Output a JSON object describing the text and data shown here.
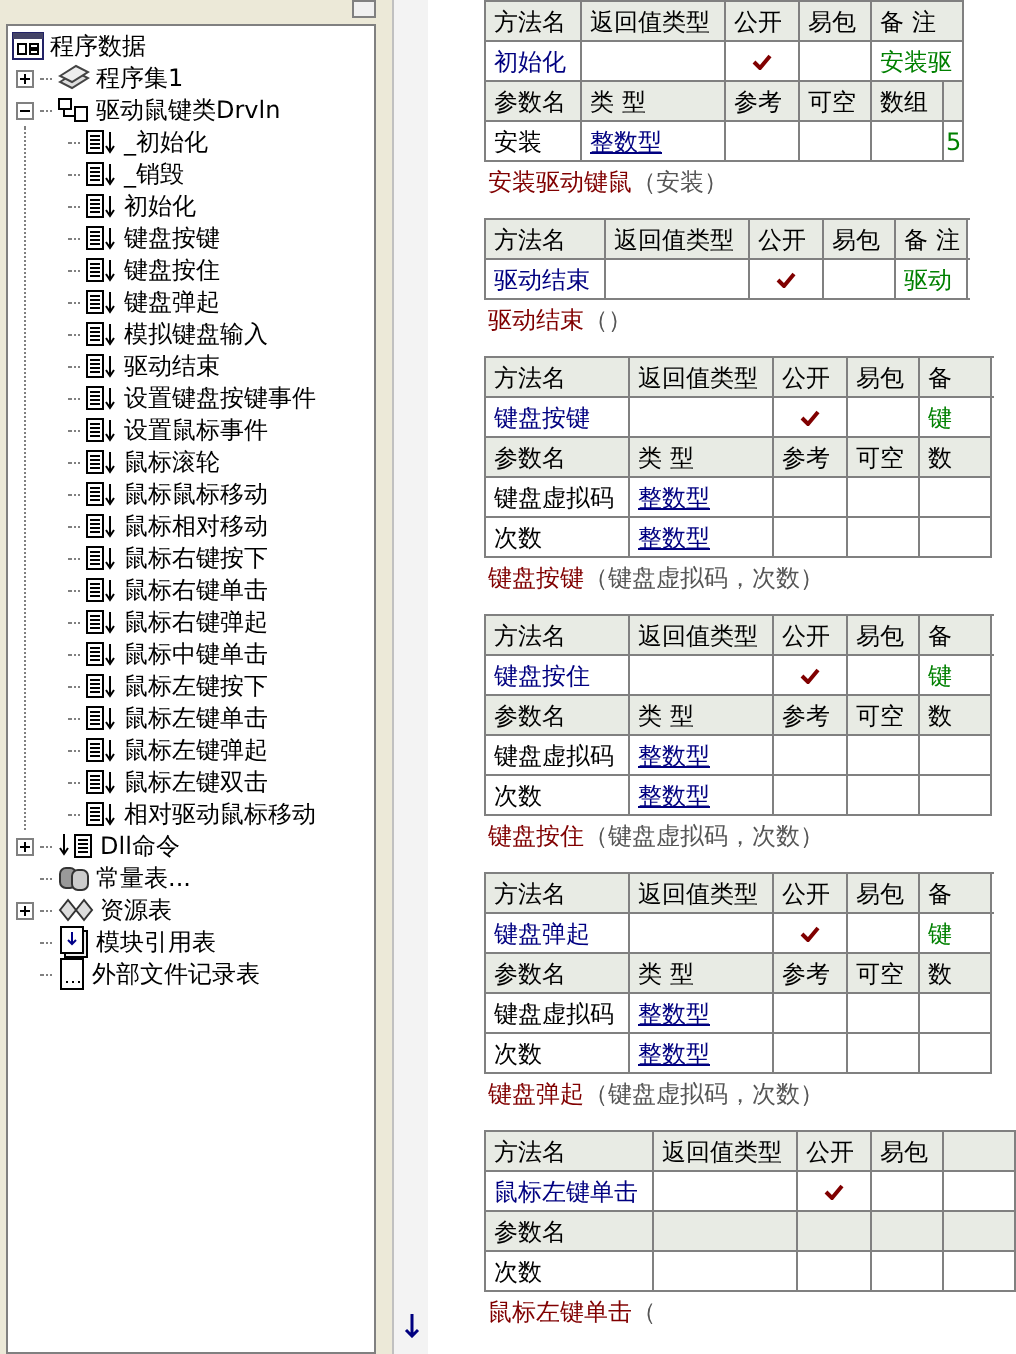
{
  "tree": {
    "root": "程序数据",
    "items": [
      {
        "kind": "assembly",
        "label": "程序集1",
        "expanded": false
      },
      {
        "kind": "class",
        "label": "驱动鼠键类Drvln",
        "expanded": true,
        "children": [
          {
            "kind": "method",
            "label": "_初始化"
          },
          {
            "kind": "method",
            "label": "_销毁"
          },
          {
            "kind": "method",
            "label": "初始化"
          },
          {
            "kind": "method",
            "label": "键盘按键"
          },
          {
            "kind": "method",
            "label": "键盘按住"
          },
          {
            "kind": "method",
            "label": "键盘弹起"
          },
          {
            "kind": "method",
            "label": "模拟键盘输入"
          },
          {
            "kind": "method",
            "label": "驱动结束"
          },
          {
            "kind": "method",
            "label": "设置键盘按键事件"
          },
          {
            "kind": "method",
            "label": "设置鼠标事件"
          },
          {
            "kind": "method",
            "label": "鼠标滚轮"
          },
          {
            "kind": "method",
            "label": "鼠标鼠标移动"
          },
          {
            "kind": "method",
            "label": "鼠标相对移动"
          },
          {
            "kind": "method",
            "label": "鼠标右键按下"
          },
          {
            "kind": "method",
            "label": "鼠标右键单击"
          },
          {
            "kind": "method",
            "label": "鼠标右键弹起"
          },
          {
            "kind": "method",
            "label": "鼠标中键单击"
          },
          {
            "kind": "method",
            "label": "鼠标左键按下"
          },
          {
            "kind": "method",
            "label": "鼠标左键单击"
          },
          {
            "kind": "method",
            "label": "鼠标左键弹起"
          },
          {
            "kind": "method",
            "label": "鼠标左键双击"
          },
          {
            "kind": "method",
            "label": "相对驱动鼠标移动"
          }
        ]
      },
      {
        "kind": "dll",
        "label": "Dll命令",
        "expanded": false
      },
      {
        "kind": "constants",
        "label": "常量表..."
      },
      {
        "kind": "resources",
        "label": "资源表",
        "expanded": false
      },
      {
        "kind": "module",
        "label": "模块引用表"
      },
      {
        "kind": "file",
        "label": "外部文件记录表"
      }
    ]
  },
  "methods": [
    {
      "method_header": [
        "方法名",
        "返回值类型",
        "公开",
        "易包",
        "备 注"
      ],
      "name": "初始化",
      "public": true,
      "remark": "安装驱",
      "param_header": [
        "参数名",
        "类 型",
        "参考",
        "可空",
        "数组"
      ],
      "params": [
        {
          "name": "安装",
          "type": "整数型",
          "remark": "5"
        }
      ],
      "signature": {
        "name": "安装驱动键鼠",
        "args": "（安装）"
      }
    },
    {
      "method_header": [
        "方法名",
        "返回值类型",
        "公开",
        "易包",
        "备 注"
      ],
      "name": "驱动结束",
      "public": true,
      "remark": "驱动",
      "signature": {
        "name": "驱动结束",
        "args": "（）"
      }
    },
    {
      "method_header": [
        "方法名",
        "返回值类型",
        "公开",
        "易包",
        "备"
      ],
      "name": "键盘按键",
      "public": true,
      "remark": "键",
      "param_header": [
        "参数名",
        "类 型",
        "参考",
        "可空",
        "数"
      ],
      "params": [
        {
          "name": "键盘虚拟码",
          "type": "整数型"
        },
        {
          "name": "次数",
          "type": "整数型"
        }
      ],
      "signature": {
        "name": "键盘按键",
        "args": "（键盘虚拟码，次数）"
      }
    },
    {
      "method_header": [
        "方法名",
        "返回值类型",
        "公开",
        "易包",
        "备"
      ],
      "name": "键盘按住",
      "public": true,
      "remark": "键",
      "param_header": [
        "参数名",
        "类 型",
        "参考",
        "可空",
        "数"
      ],
      "params": [
        {
          "name": "键盘虚拟码",
          "type": "整数型"
        },
        {
          "name": "次数",
          "type": "整数型"
        }
      ],
      "signature": {
        "name": "键盘按住",
        "args": "（键盘虚拟码，次数）"
      }
    },
    {
      "method_header": [
        "方法名",
        "返回值类型",
        "公开",
        "易包",
        "备"
      ],
      "name": "键盘弹起",
      "public": true,
      "remark": "键",
      "param_header": [
        "参数名",
        "类 型",
        "参考",
        "可空",
        "数"
      ],
      "params": [
        {
          "name": "键盘虚拟码",
          "type": "整数型"
        },
        {
          "name": "次数",
          "type": "整数型"
        }
      ],
      "signature": {
        "name": "键盘弹起",
        "args": "（键盘虚拟码，次数）"
      }
    },
    {
      "method_header": [
        "方法名",
        "返回值类型",
        "公开",
        "易包"
      ],
      "name": "鼠标左键单击",
      "public": true,
      "param_header": [
        "参数名"
      ],
      "params": [
        {
          "name": "次数"
        }
      ],
      "signature": {
        "name": "鼠标左键单击",
        "args": "（"
      }
    }
  ]
}
